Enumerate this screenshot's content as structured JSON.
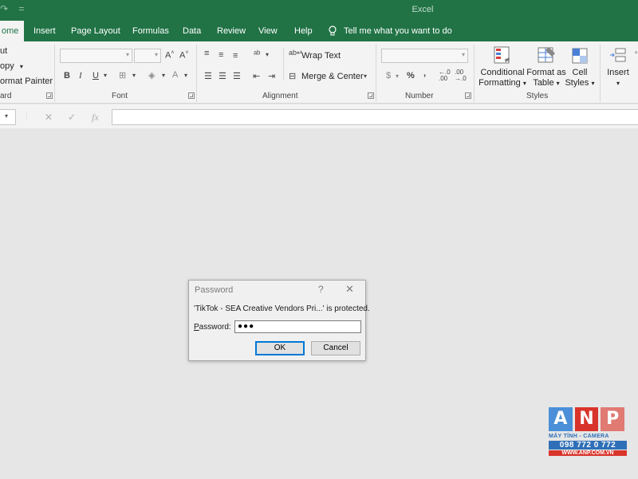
{
  "app": {
    "title": "Excel"
  },
  "tabs": [
    "ome",
    "Insert",
    "Page Layout",
    "Formulas",
    "Data",
    "Review",
    "View",
    "Help"
  ],
  "tell_me": "Tell me what you want to do",
  "clipboard": {
    "cut": "ut",
    "copy": "opy",
    "format_painter": "ormat Painter",
    "group": "ard"
  },
  "font_group": {
    "label": "Font",
    "bold": "B",
    "italic": "I",
    "underline": "U"
  },
  "alignment": {
    "wrap_text": "Wrap Text",
    "merge_center": "Merge & Center",
    "label": "Alignment"
  },
  "number": {
    "currency": "$",
    "percent": "%",
    "comma": ",",
    "label": "Number"
  },
  "styles": {
    "conditional_1": "Conditional",
    "conditional_2": "Formatting",
    "format_table_1": "Format as",
    "format_table_2": "Table",
    "cell_styles_1": "Cell",
    "cell_styles_2": "Styles",
    "label": "Styles"
  },
  "cells": {
    "insert": "Insert"
  },
  "formula_bar": {
    "cancel": "✕",
    "enter": "✓",
    "fx": "fx"
  },
  "dialog": {
    "title": "Password",
    "help": "?",
    "close": "✕",
    "message": "'TikTok - SEA Creative Vendors Pri...' is protected.",
    "password_label_p": "P",
    "password_label_rest": "assword:",
    "password_value": "●●●",
    "ok": "OK",
    "cancel": "Cancel"
  },
  "watermark": {
    "letters": [
      "A",
      "N",
      "P"
    ],
    "colors": [
      "#4b8fd8",
      "#d8342b",
      "#e07a73"
    ],
    "line1": "MÁY TÍNH - CAMERA",
    "line2": "098 772 0 772",
    "line3": "WWW.ANP.COM.VN"
  }
}
